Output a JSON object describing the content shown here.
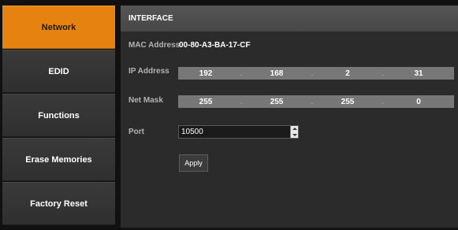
{
  "sidebar": {
    "items": [
      {
        "label": "Network",
        "active": true
      },
      {
        "label": "EDID"
      },
      {
        "label": "Functions"
      },
      {
        "label": "Erase Memories"
      },
      {
        "label": "Factory Reset"
      }
    ]
  },
  "interface": {
    "header": "INTERFACE",
    "mac_label": "MAC Address",
    "mac_value": "00-80-A3-BA-17-CF",
    "ip_label": "IP Address",
    "ip_octets": [
      "192",
      "168",
      "2",
      "31"
    ],
    "mask_label": "Net Mask",
    "mask_octets": [
      "255",
      "255",
      "255",
      "0"
    ],
    "port_label": "Port",
    "port_value": "10500",
    "separator": ".",
    "apply_label": "Apply"
  },
  "colors": {
    "accent": "#e6820f",
    "sidebar_bg": "#333333",
    "panel_bg": "#2b2b2b",
    "field_bg": "#777777"
  }
}
